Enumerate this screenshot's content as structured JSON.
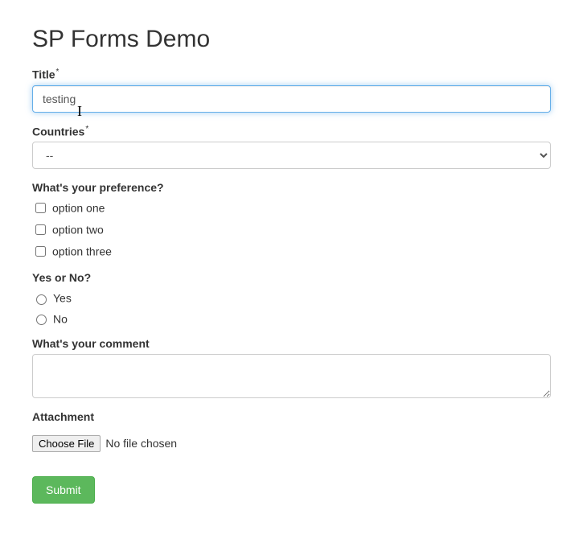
{
  "page_title": "SP Forms Demo",
  "title_field": {
    "label": "Title",
    "required_mark": "*",
    "value": "testing"
  },
  "countries_field": {
    "label": "Countries",
    "required_mark": "*",
    "selected": "--"
  },
  "preference_field": {
    "label": "What's your preference?",
    "options": [
      {
        "label": "option one"
      },
      {
        "label": "option two"
      },
      {
        "label": "option three"
      }
    ]
  },
  "yesno_field": {
    "label": "Yes or No?",
    "options": [
      {
        "label": "Yes"
      },
      {
        "label": "No"
      }
    ]
  },
  "comment_field": {
    "label": "What's your comment",
    "value": ""
  },
  "attachment_field": {
    "label": "Attachment",
    "button": "Choose File",
    "status": "No file chosen"
  },
  "submit_label": "Submit"
}
